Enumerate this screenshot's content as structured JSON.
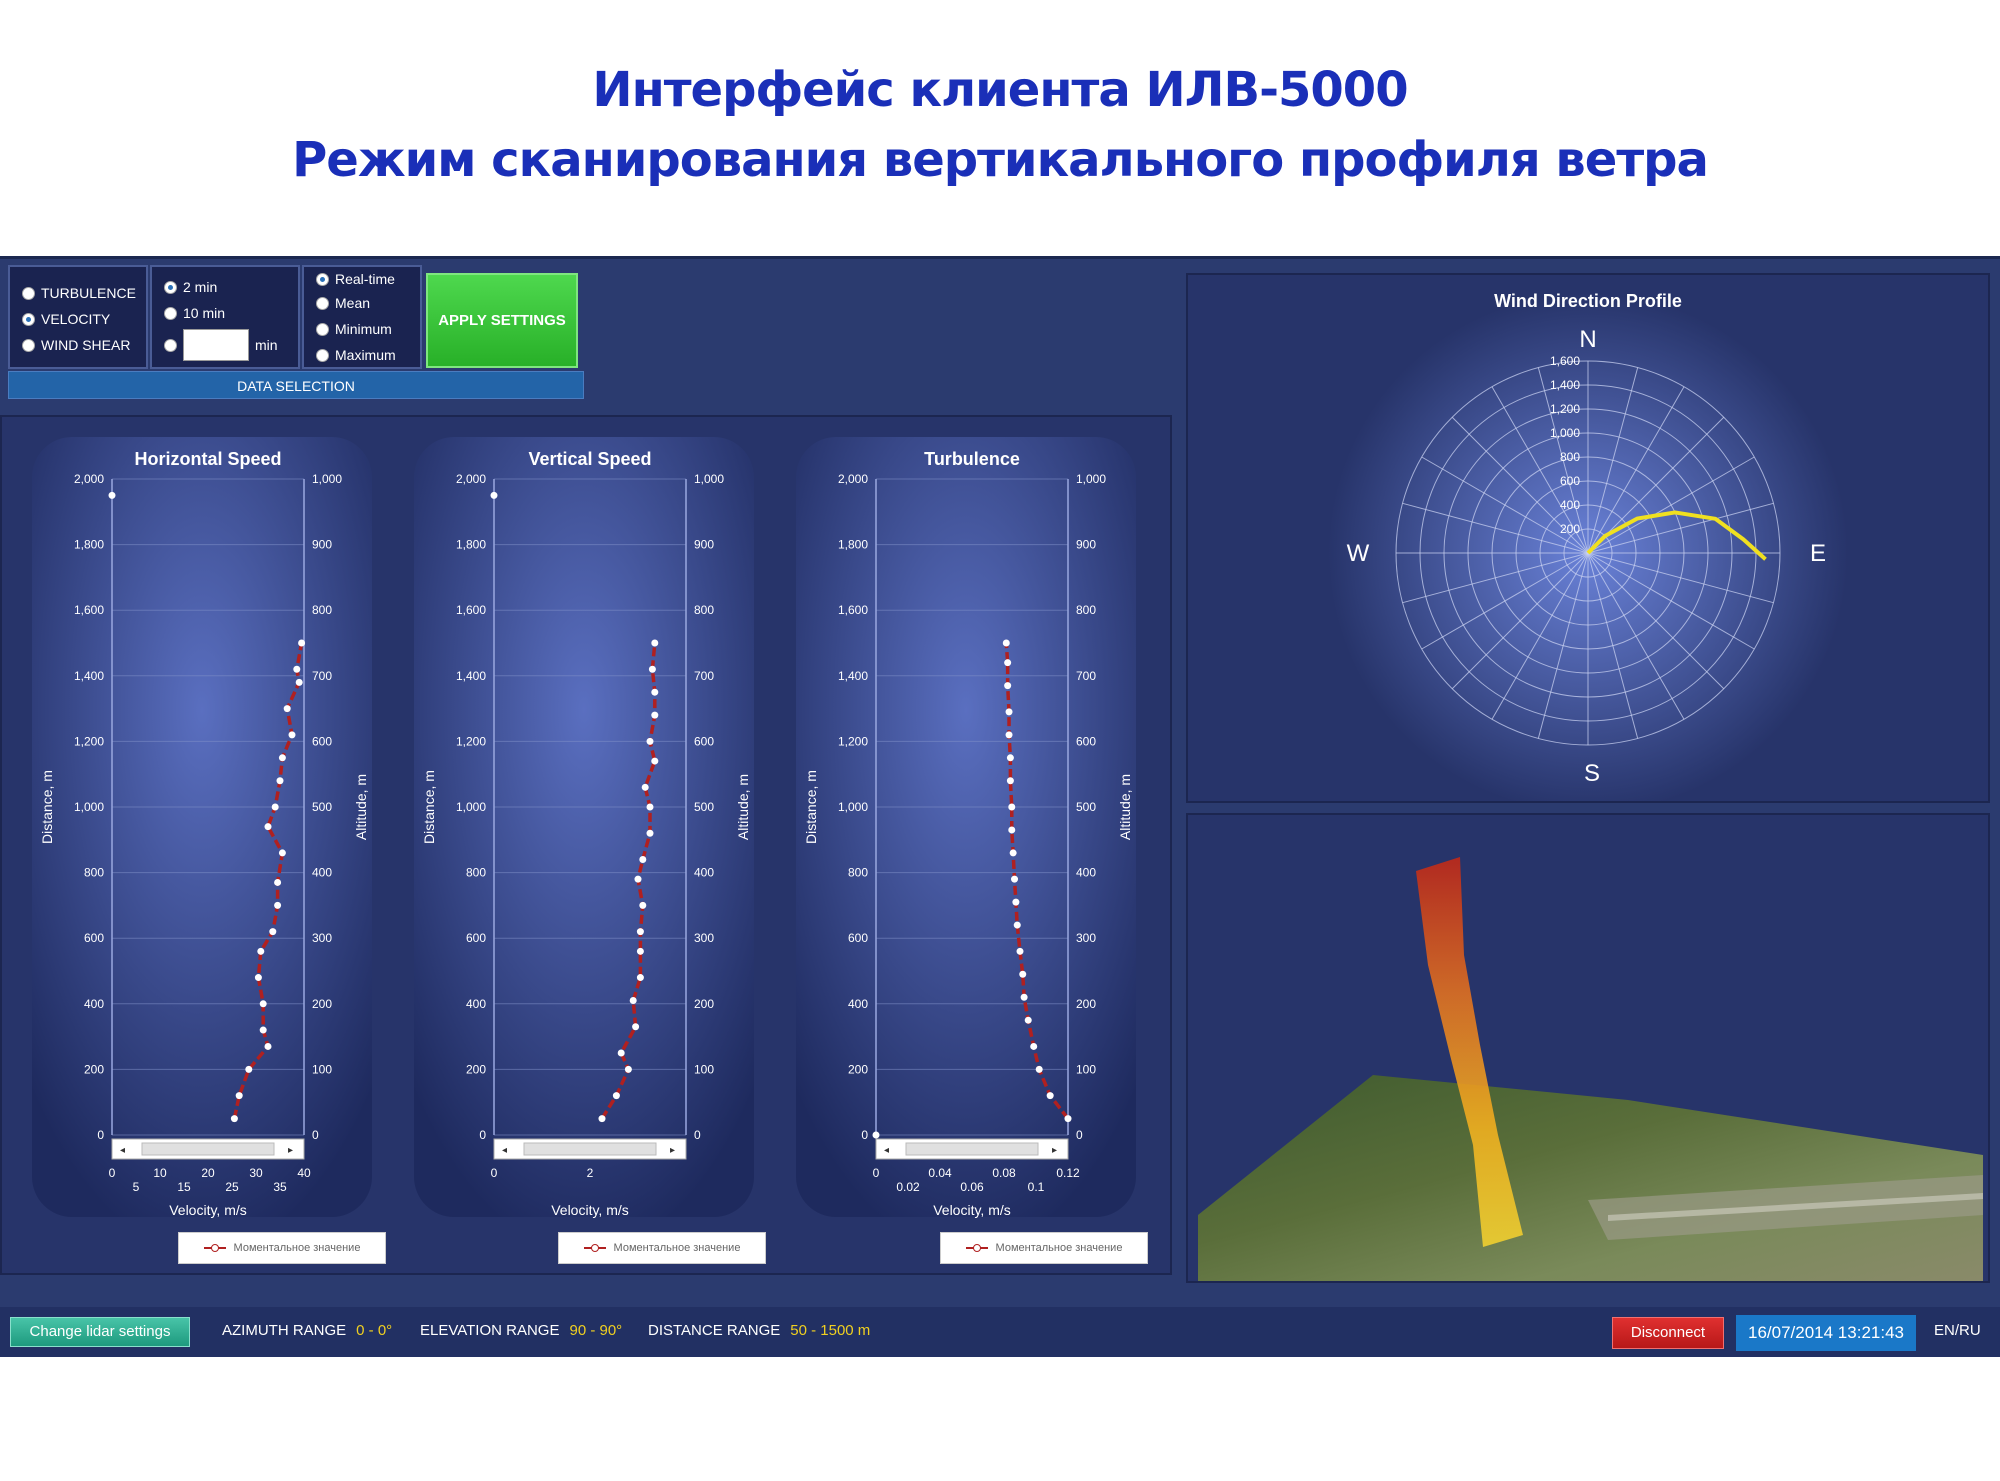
{
  "slide": {
    "title_line1": "Интерфейс клиента ИЛВ-5000",
    "title_line2": "Режим сканирования вертикального профиля ветра"
  },
  "data_selection": {
    "footer_label": "DATA SELECTION",
    "modes": [
      {
        "label": "TURBULENCE",
        "selected": false
      },
      {
        "label": "VELOCITY",
        "selected": true
      },
      {
        "label": "WIND SHEAR",
        "selected": false
      }
    ],
    "intervals": [
      {
        "label": "2 min",
        "selected": true
      },
      {
        "label": "10 min",
        "selected": false
      }
    ],
    "custom_interval": {
      "value": "",
      "unit": "min"
    },
    "stats": [
      {
        "label": "Real-time",
        "selected": true
      },
      {
        "label": "Mean",
        "selected": false
      },
      {
        "label": "Minimum",
        "selected": false
      },
      {
        "label": "Maximum",
        "selected": false
      }
    ],
    "apply_label": "APPLY SETTINGS"
  },
  "chart_data": [
    {
      "type": "line",
      "title": "Horizontal Speed",
      "xlabel": "Velocity, m/s",
      "ylabel": "Distance, m",
      "y2label": "Altitude, m",
      "xlim": [
        0,
        40
      ],
      "ylim": [
        0,
        2000
      ],
      "y2lim": [
        0,
        1000
      ],
      "xticks_top": [
        "0",
        "10",
        "20",
        "30",
        "40"
      ],
      "xticks_bottom": [
        "5",
        "15",
        "25",
        "35"
      ],
      "yticks": [
        "0",
        "200",
        "400",
        "600",
        "800",
        "1,000",
        "1,200",
        "1,400",
        "1,600",
        "1,800",
        "2,000"
      ],
      "y2ticks": [
        "0",
        "100",
        "200",
        "300",
        "400",
        "500",
        "600",
        "700",
        "800",
        "900",
        "1,000"
      ],
      "legend": "Моментальное значение",
      "series": [
        {
          "x": [
            25.5,
            26.5,
            28.5,
            32.5,
            31.5,
            31.5,
            30.5,
            31,
            33.5,
            34.5,
            34.5,
            35.5,
            32.5,
            34,
            35,
            35.5,
            37.5,
            36.5,
            39,
            38.5,
            39.5
          ],
          "y": [
            50,
            120,
            200,
            270,
            320,
            400,
            480,
            560,
            620,
            700,
            770,
            860,
            940,
            1000,
            1080,
            1150,
            1220,
            1300,
            1380,
            1420,
            1500
          ]
        }
      ],
      "marker": {
        "x": 0,
        "y": 1950
      }
    },
    {
      "type": "line",
      "title": "Vertical Speed",
      "xlabel": "Velocity, m/s",
      "ylabel": "Distance, m",
      "y2label": "Altitude, m",
      "xlim": [
        0,
        4
      ],
      "ylim": [
        0,
        2000
      ],
      "y2lim": [
        0,
        1000
      ],
      "xticks_top": [],
      "xticks_bottom": [
        "0",
        "2"
      ],
      "yticks": [
        "0",
        "200",
        "400",
        "600",
        "800",
        "1,000",
        "1,200",
        "1,400",
        "1,600",
        "1,800",
        "2,000"
      ],
      "y2ticks": [
        "0",
        "100",
        "200",
        "300",
        "400",
        "500",
        "600",
        "700",
        "800",
        "900",
        "1,000"
      ],
      "legend": "Моментальное значение",
      "series": [
        {
          "x": [
            2.25,
            2.55,
            2.8,
            2.65,
            2.95,
            2.9,
            3.05,
            3.05,
            3.05,
            3.1,
            3.0,
            3.1,
            3.25,
            3.25,
            3.15,
            3.35,
            3.25,
            3.35,
            3.35,
            3.3,
            3.35
          ],
          "y": [
            50,
            120,
            200,
            250,
            330,
            410,
            480,
            560,
            620,
            700,
            780,
            840,
            920,
            1000,
            1060,
            1140,
            1200,
            1280,
            1350,
            1420,
            1500
          ]
        }
      ],
      "marker": {
        "x": 0,
        "y": 1950
      }
    },
    {
      "type": "line",
      "title": "Turbulence",
      "xlabel": "Velocity, m/s",
      "ylabel": "Distance, m",
      "y2label": "Altitude, m",
      "xlim": [
        0,
        0.14
      ],
      "ylim": [
        0,
        2000
      ],
      "y2lim": [
        0,
        1000
      ],
      "xticks_top": [
        "0",
        "0.04",
        "0.08",
        "0.12"
      ],
      "xticks_bottom": [
        "0.02",
        "0.06",
        "0.1"
      ],
      "yticks": [
        "0",
        "200",
        "400",
        "600",
        "800",
        "1,000",
        "1,200",
        "1,400",
        "1,600",
        "1,800",
        "2,000"
      ],
      "y2ticks": [
        "0",
        "100",
        "200",
        "300",
        "400",
        "500",
        "600",
        "700",
        "800",
        "900",
        "1,000"
      ],
      "legend": "Моментальное значение",
      "series": [
        {
          "x": [
            0.14,
            0.127,
            0.119,
            0.115,
            0.111,
            0.108,
            0.107,
            0.105,
            0.103,
            0.102,
            0.101,
            0.1,
            0.099,
            0.099,
            0.098,
            0.098,
            0.097,
            0.097,
            0.096,
            0.096,
            0.095
          ],
          "y": [
            50,
            120,
            200,
            270,
            350,
            420,
            490,
            560,
            640,
            710,
            780,
            860,
            930,
            1000,
            1080,
            1150,
            1220,
            1290,
            1370,
            1440,
            1500
          ]
        }
      ],
      "marker": {
        "x": 0,
        "y": 0
      }
    },
    {
      "type": "scatter",
      "title": "Wind Direction Profile",
      "directions": [
        "N",
        "E",
        "S",
        "W"
      ],
      "radial_ticks": [
        "200",
        "400",
        "600",
        "800",
        "1,000",
        "1,200",
        "1,400",
        "1,600"
      ],
      "rlim": [
        0,
        1600
      ],
      "series": [
        {
          "azimuth_deg": [
            0,
            45,
            55,
            65,
            75,
            85,
            92
          ],
          "distance_m": [
            0,
            200,
            500,
            800,
            1100,
            1300,
            1480
          ]
        }
      ]
    }
  ],
  "status_bar": {
    "change_lidar_label": "Change lidar settings",
    "azimuth_label": "AZIMUTH RANGE",
    "azimuth_value": "0 - 0°",
    "elevation_label": "ELEVATION RANGE",
    "elevation_value": "90 - 90°",
    "distance_label": "DISTANCE RANGE",
    "distance_value": "50 - 1500 m",
    "disconnect_label": "Disconnect",
    "datetime": "16/07/2014 13:21:43",
    "language": "EN/RU"
  },
  "colors": {
    "title": "#1a2fb8",
    "panel": "#27346a",
    "series_line": "#b02020",
    "wind_profile": "#f0e020",
    "apply": "#2fbf2f",
    "disconnect": "#d02020",
    "datetime_bg": "#1a78c8",
    "status_value": "#f0d020"
  }
}
